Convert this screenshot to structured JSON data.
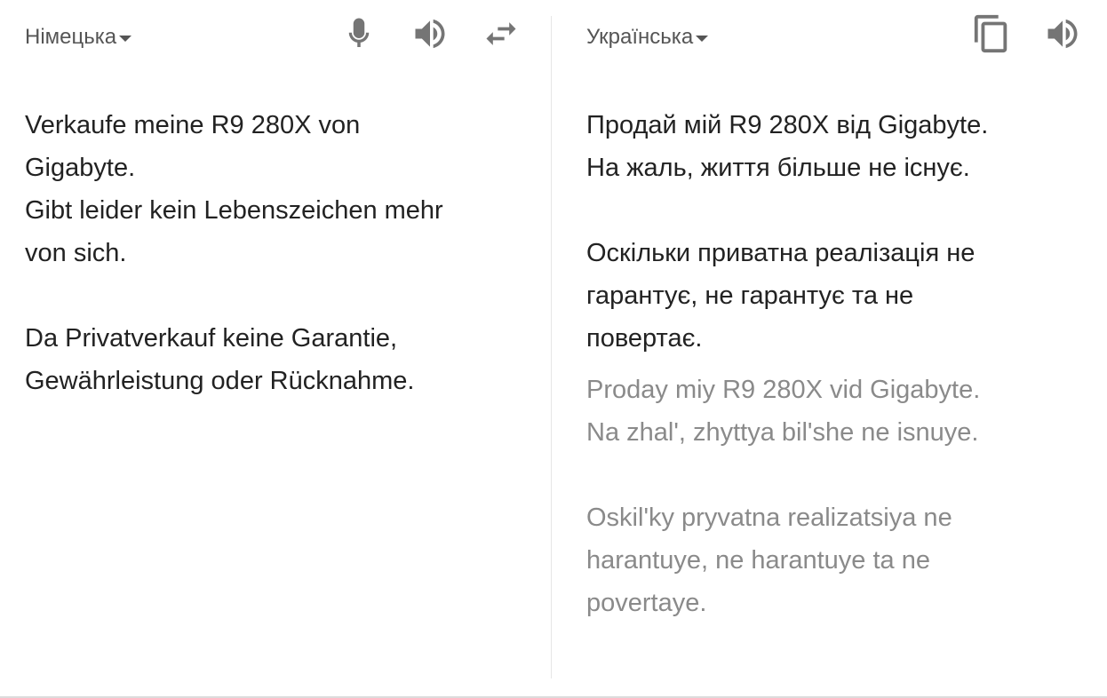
{
  "source": {
    "language": "Німецька",
    "text": "Verkaufe meine R9 280X von\nGigabyte.\nGibt leider kein Lebenszeichen mehr\nvon sich.\n\nDa Privatverkauf keine Garantie,\nGewährleistung oder Rücknahme."
  },
  "target": {
    "language": "Українська",
    "text": "Продай мій R9 280X від Gigabyte.\nНа жаль, життя більше не існує.\n\nОскільки приватна реалізація не\nгарантує, не гарантує та не\nповертає.",
    "transliteration": "Proday miy R9 280X vid Gigabyte.\nNa zhal', zhyttya bil'she ne isnuye.\n\nOskil'ky pryvatna realizatsiya ne\nharantuye, ne harantuye ta ne\npovertaye."
  },
  "icons": {
    "microphone": "microphone-icon",
    "speaker": "speaker-icon",
    "swap": "swap-languages-icon",
    "copy": "copy-icon"
  },
  "colors": {
    "text": "#222222",
    "muted_text": "#8a8a8a",
    "icon": "#757575",
    "divider": "#e6e6e6"
  }
}
